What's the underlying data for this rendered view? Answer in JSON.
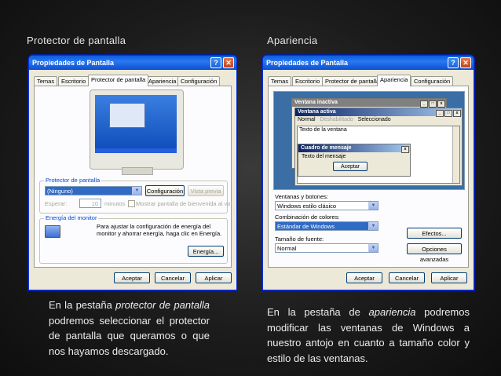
{
  "left": {
    "heading": "Protector de pantalla",
    "window": {
      "title": "Propiedades de Pantalla",
      "help_glyph": "?",
      "close_glyph": "✕",
      "tabs": [
        "Temas",
        "Escritorio",
        "Protector de pantalla",
        "Apariencia",
        "Configuración"
      ],
      "active_tab": 2,
      "screensaver_group": "Protector de pantalla",
      "screensaver_value": "(Ninguno)",
      "config_button": "Configuración",
      "preview_button": "Vista previa",
      "wait_label": "Esperar:",
      "wait_value": "10",
      "minutes_label": "minutos",
      "welcome_label": "Mostrar pantalla de bienvenida al vol",
      "energy_group": "Energía del monitor",
      "energy_text": "Para ajustar la configuración de energía del monitor y ahorrar energía, haga clic en Energía.",
      "energy_button": "Energía...",
      "ok": "Aceptar",
      "cancel": "Cancelar",
      "apply": "Aplicar"
    },
    "caption_parts": [
      "En la pestaña ",
      "protector de pantalla",
      " podremos seleccionar el protector de pantalla que queramos o que nos hayamos descargado."
    ]
  },
  "right": {
    "heading": "Apariencia",
    "window": {
      "title": "Propiedades de Pantalla",
      "help_glyph": "?",
      "close_glyph": "✕",
      "tabs": [
        "Temas",
        "Escritorio",
        "Protector de pantalla",
        "Apariencia",
        "Configuración"
      ],
      "active_tab": 3,
      "inactive_window": "Ventana inactiva",
      "active_window": "Ventana activa",
      "menu_normal": "Normal",
      "menu_disabled": "Deshabilitado",
      "menu_selected": "Seleccionado",
      "window_text": "Texto de la ventana",
      "msgbox_title": "Cuadro de mensaje",
      "msgbox_text": "Texto del mensaje",
      "msgbox_ok": "Aceptar",
      "windows_buttons_label": "Ventanas y botones:",
      "windows_buttons_value": "Windows estilo clásico",
      "color_scheme_label": "Combinación de colores:",
      "color_scheme_value": "Estándar de Windows",
      "font_size_label": "Tamaño de fuente:",
      "font_size_value": "Normal",
      "effects_button": "Efectos...",
      "advanced_button": "Opciones avanzadas",
      "ok": "Aceptar",
      "cancel": "Cancelar",
      "apply": "Aplicar"
    },
    "caption_parts": [
      "En la pestaña de ",
      "apariencia",
      " podremos modificar las ventanas de Windows a nuestro antojo en cuanto a tamaño color y estilo de las ventanas."
    ]
  },
  "colors": {
    "background": "#1c1c1c",
    "xp_title_blue": "#0a5ddf",
    "xp_face": "#ece9d8",
    "selection_blue": "#316ac5"
  }
}
